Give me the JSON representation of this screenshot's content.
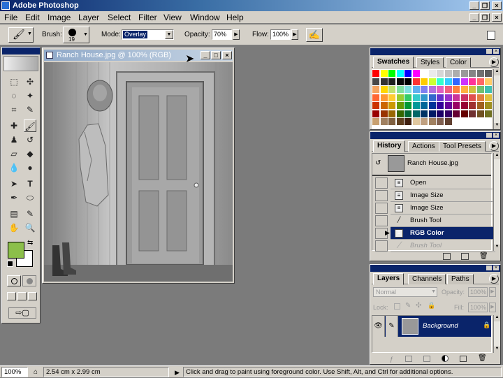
{
  "app": {
    "title": "Adobe Photoshop",
    "accent": "#0a246a"
  },
  "window_buttons": {
    "minimize": "_",
    "restore": "❐",
    "close": "×"
  },
  "menu": [
    "File",
    "Edit",
    "Image",
    "Layer",
    "Select",
    "Filter",
    "View",
    "Window",
    "Help"
  ],
  "options": {
    "brush_label": "Brush:",
    "brush_size": "19",
    "mode_label": "Mode:",
    "mode_value": "Overlay",
    "opacity_label": "Opacity:",
    "opacity_value": "70%",
    "flow_label": "Flow:",
    "flow_value": "100%"
  },
  "colors": {
    "foreground": "#8cbf4a",
    "background": "#ffffff"
  },
  "document": {
    "title": "Ranch House.jpg @ 100% (RGB)"
  },
  "swatches_panel": {
    "tabs": [
      "Swatches",
      "Styles",
      "Color"
    ],
    "active_tab": "Swatches",
    "rows": [
      [
        "#ff0000",
        "#ffff00",
        "#00ff00",
        "#00ffff",
        "#0000ff",
        "#ff00ff",
        "#ffffff",
        "#ebebeb",
        "#d6d6d6",
        "#c2c2c2",
        "#adadad",
        "#999999",
        "#858585",
        "#707070",
        "#5c5c5c"
      ],
      [
        "#474747",
        "#333333",
        "#1f1f1f",
        "#0a0a0a",
        "#000000",
        "#ff3333",
        "#ffcc00",
        "#ccff33",
        "#33ffcc",
        "#33ccff",
        "#3366ff",
        "#cc33ff",
        "#ff3399",
        "#ff6666",
        "#ffcc66"
      ],
      [
        "#f4a460",
        "#ffd700",
        "#c0e070",
        "#80e0a0",
        "#80e0e0",
        "#60b0f0",
        "#8080f0",
        "#b070e0",
        "#e060c0",
        "#f06080",
        "#ff8040",
        "#ffb040",
        "#d0c040",
        "#70c070",
        "#40c0b0"
      ],
      [
        "#ff6633",
        "#ff9933",
        "#ffcc33",
        "#99cc33",
        "#33cc66",
        "#33cccc",
        "#3399cc",
        "#3366cc",
        "#6633cc",
        "#9933cc",
        "#cc3399",
        "#cc3366",
        "#e05050",
        "#e08040",
        "#e0c040"
      ],
      [
        "#cc3300",
        "#cc6600",
        "#cc9900",
        "#669900",
        "#009933",
        "#009999",
        "#006699",
        "#003399",
        "#330099",
        "#660099",
        "#990066",
        "#990033",
        "#a03030",
        "#a06020",
        "#a09020"
      ],
      [
        "#990000",
        "#993300",
        "#996600",
        "#336600",
        "#006633",
        "#006666",
        "#003366",
        "#001a66",
        "#1a0066",
        "#330066",
        "#660033",
        "#660000",
        "#703030",
        "#705020",
        "#707020"
      ],
      [
        "#c8a070",
        "#a08060",
        "#806040",
        "#604020",
        "#402010",
        "#e0c8a0",
        "#c0a080",
        "#a08060",
        "#806050",
        "#604030"
      ]
    ]
  },
  "history_panel": {
    "tabs": [
      "History",
      "Actions",
      "Tool Presets"
    ],
    "active_tab": "History",
    "snapshot": "Ranch House.jpg",
    "items": [
      {
        "label": "Open",
        "state": "normal"
      },
      {
        "label": "Image Size",
        "state": "normal"
      },
      {
        "label": "Image Size",
        "state": "normal"
      },
      {
        "label": "Brush Tool",
        "state": "normal"
      },
      {
        "label": "RGB Color",
        "state": "selected"
      },
      {
        "label": "Brush Tool",
        "state": "disabled"
      }
    ]
  },
  "layers_panel": {
    "tabs": [
      "Layers",
      "Channels",
      "Paths"
    ],
    "active_tab": "Layers",
    "blend_mode": "Normal",
    "opacity_label": "Opacity:",
    "opacity_value": "100%",
    "lock_label": "Lock:",
    "fill_label": "Fill:",
    "fill_value": "100%",
    "layers": [
      {
        "name": "Background",
        "visible": true,
        "locked": true
      }
    ]
  },
  "status": {
    "zoom": "100%",
    "doc_size": "2.54 cm x 2.99 cm",
    "hint": "Click and drag to paint using foreground color.  Use Shift, Alt, and Ctrl for additional options."
  }
}
